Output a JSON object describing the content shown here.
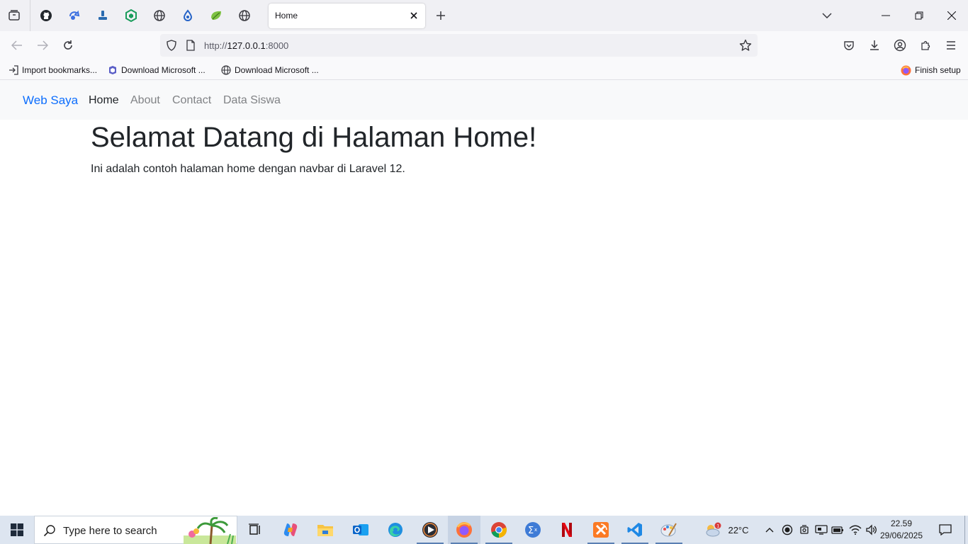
{
  "browser": {
    "tab_title": "Home",
    "url_scheme": "http://",
    "url_host": "127.0.0.1",
    "url_port": ":8000",
    "pinned_tabs": [
      "tab-overview-icon",
      "github-icon",
      "shortcut-icon",
      "vercel-icon",
      "app-cube-icon",
      "globe-icon",
      "drop-icon",
      "leaf-icon",
      "globe-icon"
    ],
    "bookmarks": [
      {
        "label": "Import bookmarks...",
        "icon": "import-icon"
      },
      {
        "label": "Download Microsoft ...",
        "icon": "microsoft-icon"
      },
      {
        "label": "Download Microsoft ...",
        "icon": "globe-icon"
      }
    ],
    "finish_setup": "Finish setup"
  },
  "site": {
    "brand": "Web Saya",
    "nav": [
      {
        "label": "Home",
        "active": true
      },
      {
        "label": "About",
        "active": false
      },
      {
        "label": "Contact",
        "active": false
      },
      {
        "label": "Data Siswa",
        "active": false
      }
    ],
    "heading": "Selamat Datang di Halaman Home!",
    "lead": "Ini adalah contoh halaman home dengan navbar di Laravel 12."
  },
  "taskbar": {
    "search_placeholder": "Type here to search",
    "weather_temp": "22°C",
    "weather_badge": "1",
    "time": "22.59",
    "date": "29/06/2025",
    "apps": [
      "task-view-icon",
      "copilot-icon",
      "file-explorer-icon",
      "outlook-icon",
      "edge-icon",
      "media-player-icon",
      "firefox-icon",
      "chrome-icon",
      "calculator-icon",
      "netflix-icon",
      "xampp-icon",
      "vscode-icon",
      "paint-icon"
    ]
  },
  "colors": {
    "brand_blue": "#0d6efd",
    "navbar_bg": "#f8f9fa",
    "taskbar_bg": "#dde5f0"
  }
}
